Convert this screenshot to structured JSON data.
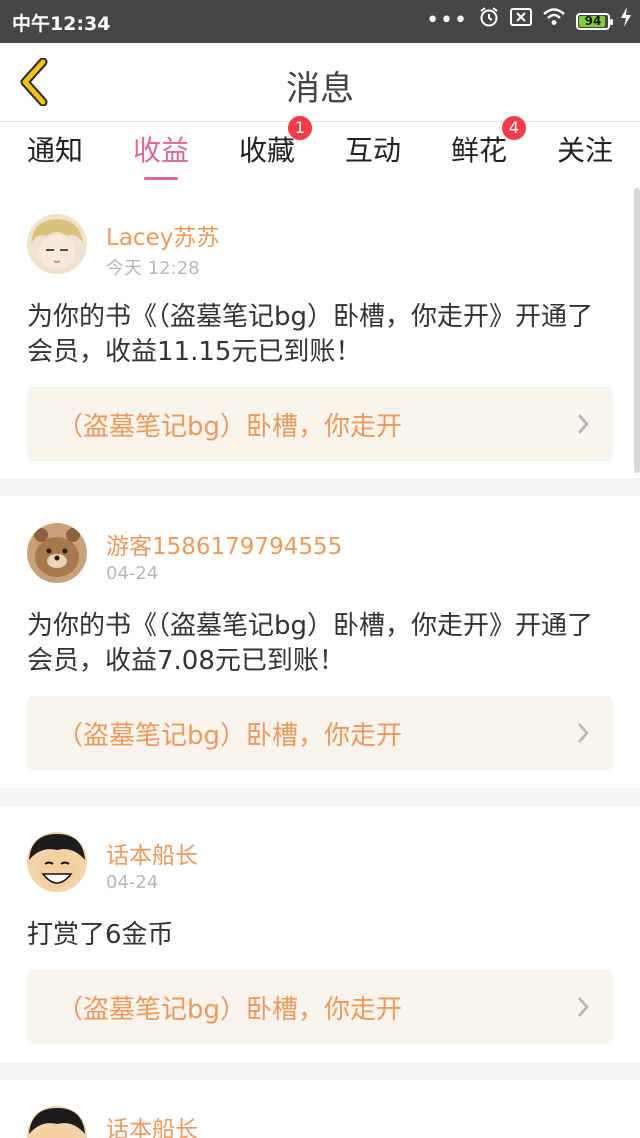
{
  "status_bar": {
    "time": "中午12:34",
    "battery": "94",
    "battery_level_percent": 94
  },
  "nav": {
    "title": "消息"
  },
  "tabs": [
    {
      "label": "通知",
      "badge": ""
    },
    {
      "label": "收益",
      "badge": ""
    },
    {
      "label": "收藏",
      "badge": "1"
    },
    {
      "label": "互动",
      "badge": ""
    },
    {
      "label": "鲜花",
      "badge": "4"
    },
    {
      "label": "关注",
      "badge": ""
    }
  ],
  "active_tab": "收益",
  "messages": [
    {
      "user": "Lacey苏苏",
      "time": "今天 12:28",
      "text": "为你的书《（盗墓笔记bg）卧槽，你走开》开通了会员，收益11.15元已到账！",
      "book": "（盗墓笔记bg）卧槽，你走开"
    },
    {
      "user": "游客1586179794555",
      "time": "04-24",
      "text": "为你的书《（盗墓笔记bg）卧槽，你走开》开通了会员，收益7.08元已到账！",
      "book": "（盗墓笔记bg）卧槽，你走开"
    },
    {
      "user": "话本船长",
      "time": "04-24",
      "text": "打赏了6金币",
      "book": "（盗墓笔记bg）卧槽，你走开"
    },
    {
      "user": "话本船长",
      "time": "",
      "text": "",
      "book": ""
    }
  ],
  "colors": {
    "accent_pink": "#e0669a",
    "username_orange": "#ef9a5c",
    "badge_red": "#f33b4a",
    "back_arrow_yellow": "#f2c21a",
    "link_bg": "#f6f4ec"
  }
}
